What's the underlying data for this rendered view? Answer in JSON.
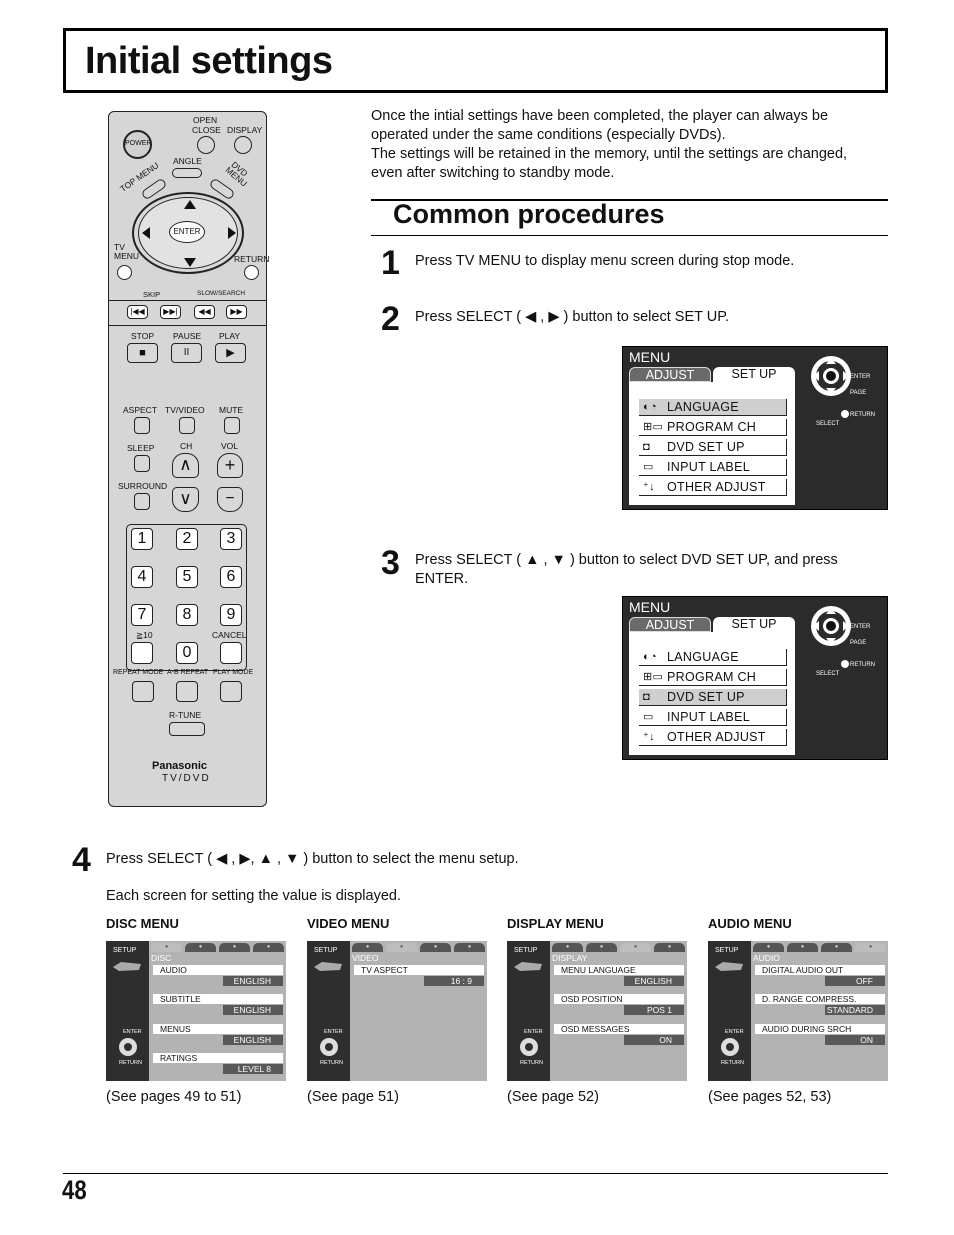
{
  "page_title": "Initial settings",
  "intro": {
    "line1": "Once the intial settings have been completed, the player can always be",
    "line2": "operated under the same conditions (especially DVDs).",
    "line3": "The settings will be retained in the memory, until the settings are changed,",
    "line4": "even after switching to standby mode."
  },
  "section_title": "Common procedures",
  "steps": [
    {
      "num": "1",
      "text": "Press TV MENU to display menu screen during stop mode."
    },
    {
      "num": "2",
      "text": "Press SELECT ( ◀ , ▶ ) button to select SET UP."
    },
    {
      "num": "3",
      "text_line1": "Press SELECT ( ▲ , ▼ ) button to select DVD SET UP, and press",
      "text_line2": "ENTER."
    },
    {
      "num": "4",
      "text": "Press SELECT ( ◀ , ▶, ▲ , ▼ ) button to select the menu setup.",
      "subtext": "Each screen for setting the value is displayed."
    }
  ],
  "tv_menu": {
    "title": "MENU",
    "tab_adjust": "ADJUST",
    "tab_setup": "SET  UP",
    "items": [
      "LANGUAGE",
      "PROGRAM  CH",
      "DVD  SET  UP",
      "INPUT  LABEL",
      "OTHER  ADJUST"
    ],
    "icons": [
      "language-icon",
      "program-ch-icon",
      "dvd-setup-icon",
      "input-label-icon",
      "other-adjust-icon"
    ],
    "pad_labels": {
      "enter": "ENTER",
      "page": "PAGE",
      "return": "RETURN",
      "select": "SELECT"
    },
    "step2_selected": "LANGUAGE",
    "step3_selected": "DVD  SET  UP"
  },
  "setup_screens": [
    {
      "heading": "DISC MENU",
      "category": "DISC",
      "active_tab": 0,
      "rows": [
        {
          "label": "AUDIO",
          "value": "ENGLISH"
        },
        {
          "label": "SUBTITLE",
          "value": "ENGLISH"
        },
        {
          "label": "MENUS",
          "value": "ENGLISH"
        },
        {
          "label": "RATINGS",
          "value": "LEVEL 8"
        }
      ],
      "see": "(See pages 49 to 51)"
    },
    {
      "heading": "VIDEO MENU",
      "category": "VIDEO",
      "active_tab": 1,
      "rows": [
        {
          "label": "TV ASPECT",
          "value": "16 : 9"
        }
      ],
      "see": "(See page 51)"
    },
    {
      "heading": "DISPLAY MENU",
      "category": "DISPLAY",
      "active_tab": 2,
      "rows": [
        {
          "label": "MENU LANGUAGE",
          "value": "ENGLISH"
        },
        {
          "label": "OSD POSITION",
          "value": "POS  1"
        },
        {
          "label": "OSD MESSAGES",
          "value": "ON"
        }
      ],
      "see": "(See page 52)"
    },
    {
      "heading": "AUDIO MENU",
      "category": "AUDIO",
      "active_tab": 3,
      "rows": [
        {
          "label": "DIGITAL AUDIO OUT",
          "value": "OFF"
        },
        {
          "label": "D. RANGE COMPRESS.",
          "value": "STANDARD"
        },
        {
          "label": "AUDIO DURING SRCH",
          "value": "ON"
        }
      ],
      "see": "(See pages 52, 53)"
    }
  ],
  "setup_side": {
    "setup": "SETUP",
    "enter": "ENTER",
    "return": "RETURN"
  },
  "remote": {
    "power": "POWER",
    "open_close": "OPEN\nCLOSE",
    "open": "OPEN",
    "close": "CLOSE",
    "display": "DISPLAY",
    "top_menu": "TOP MENU",
    "angle": "ANGLE",
    "dvd_menu": "DVD MENU",
    "enter": "ENTER",
    "tv_menu": "TV",
    "tv_menu2": "MENU",
    "return": "RETURN",
    "skip": "SKIP",
    "slow_search": "SLOW/SEARCH",
    "stop": "STOP",
    "pause": "PAUSE",
    "play": "PLAY",
    "aspect": "ASPECT",
    "tv_video": "TV/VIDEO",
    "mute": "MUTE",
    "sleep": "SLEEP",
    "ch": "CH",
    "vol": "VOL",
    "surround": "SURROUND",
    "digits": [
      "1",
      "2",
      "3",
      "4",
      "5",
      "6",
      "7",
      "8",
      "9",
      "0"
    ],
    "ten_plus": "≧10",
    "cancel": "CANCEL",
    "repeat_mode": "REPEAT MODE",
    "ab_repeat": "A-B REPEAT",
    "play_mode": "PLAY MODE",
    "r_tune": "R-TUNE",
    "brand": "Panasonic",
    "model": "TV/DVD"
  },
  "page_number": "48"
}
